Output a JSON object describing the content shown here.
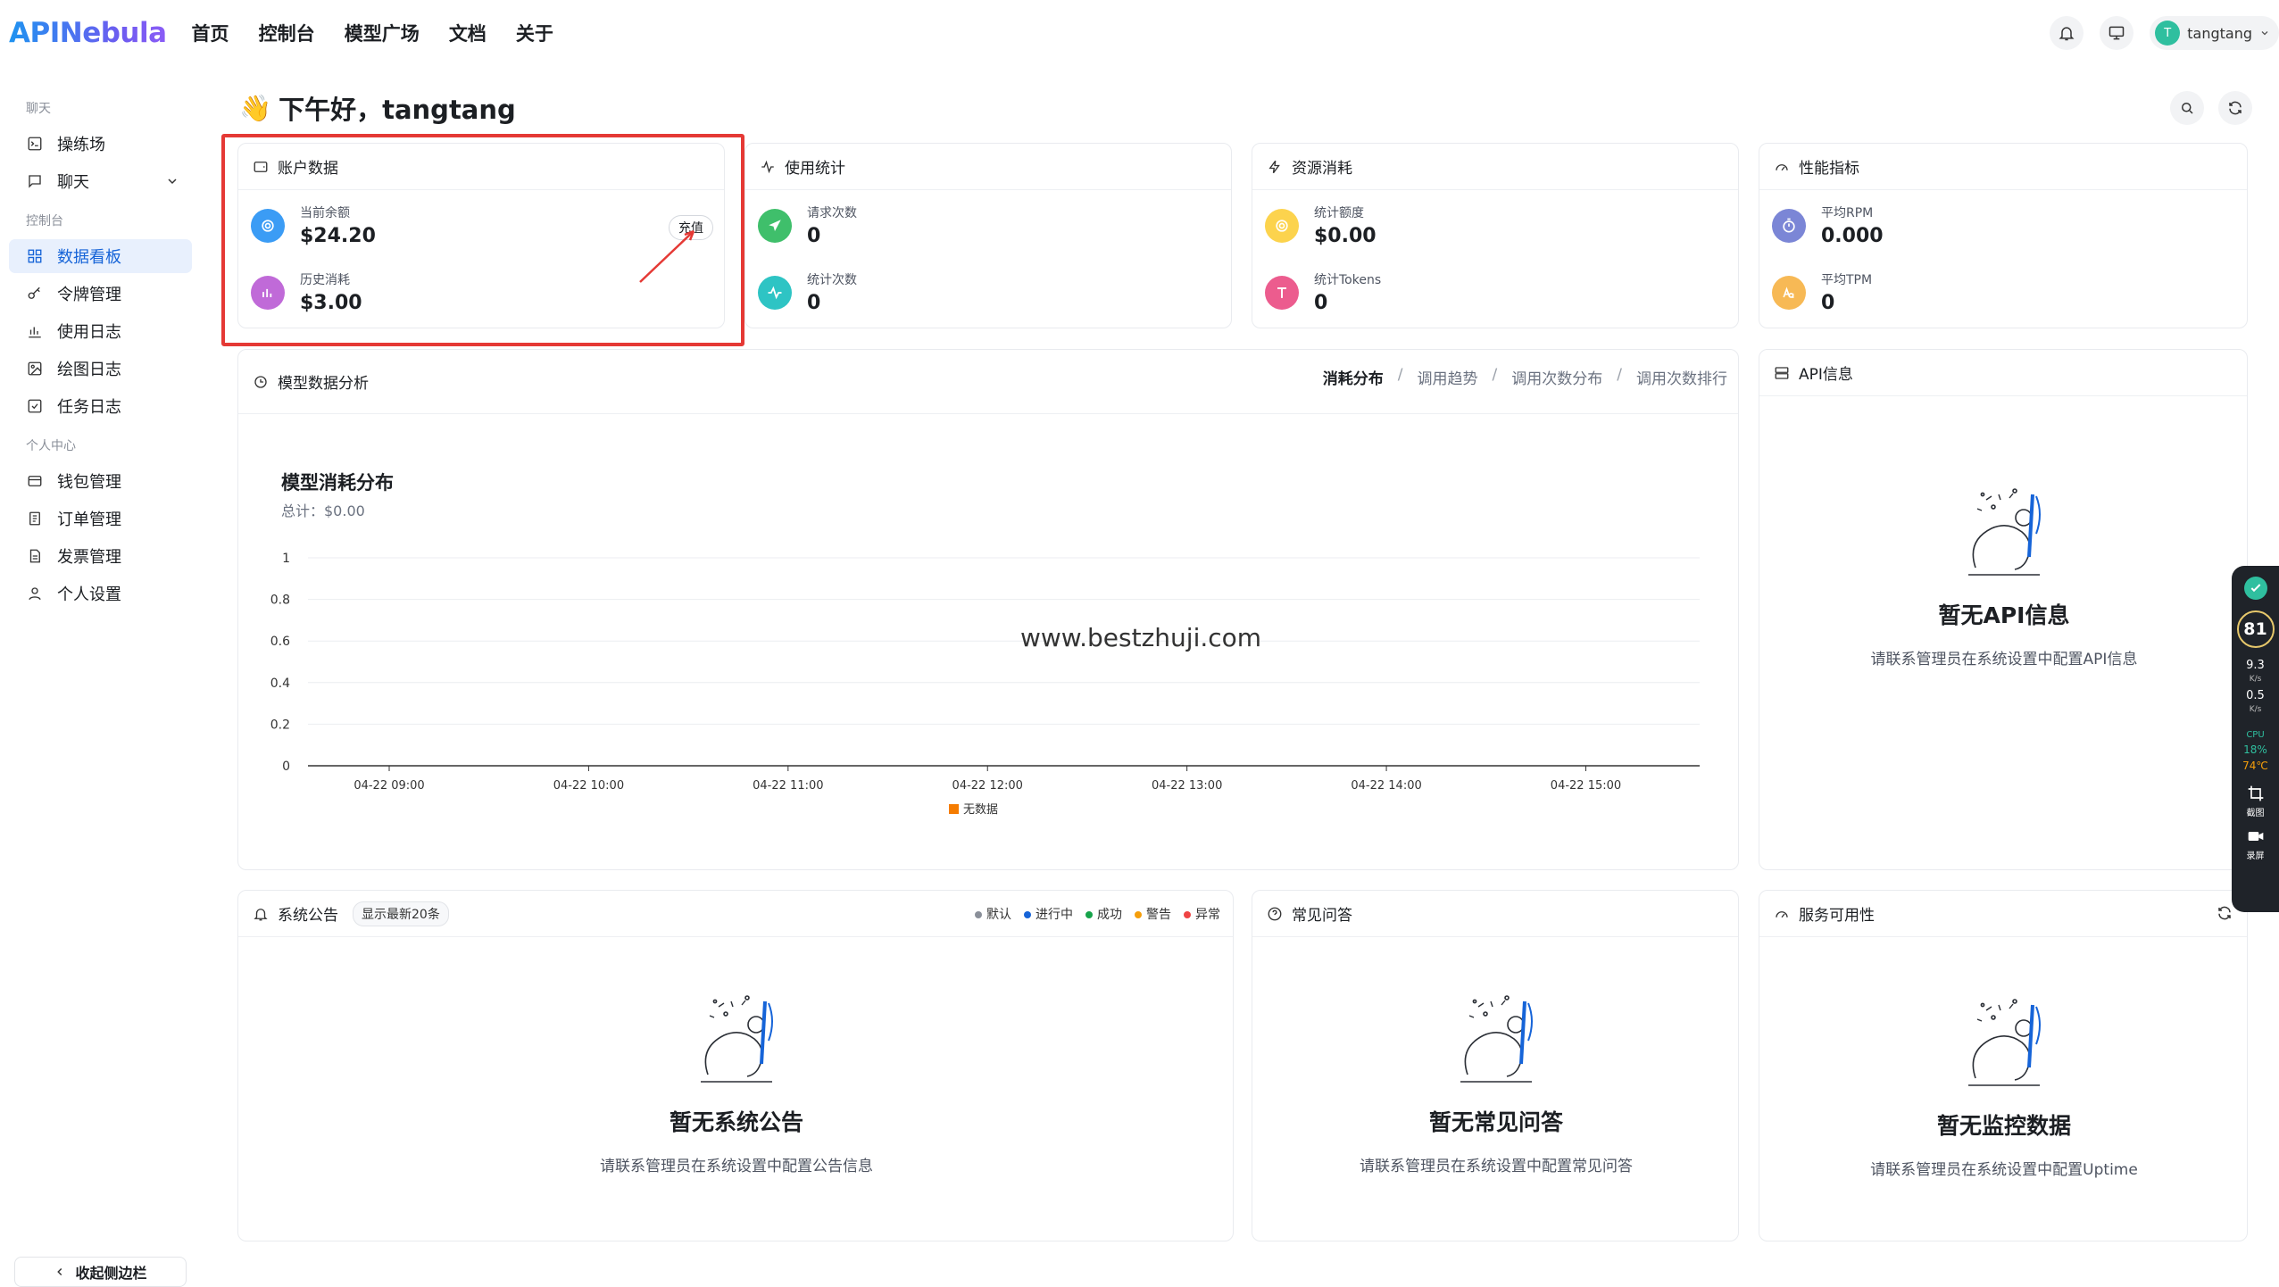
{
  "app": {
    "logo": "APINebula"
  },
  "nav": [
    "首页",
    "控制台",
    "模型广场",
    "文档",
    "关于"
  ],
  "user": {
    "initial": "T",
    "name": "tangtang"
  },
  "sidebar": {
    "group_chat": "聊天",
    "playground": "操练场",
    "chat": "聊天",
    "group_console": "控制台",
    "dashboard": "数据看板",
    "tokens": "令牌管理",
    "usage_log": "使用日志",
    "draw_log": "绘图日志",
    "task_log": "任务日志",
    "group_personal": "个人中心",
    "wallet": "钱包管理",
    "orders": "订单管理",
    "invoices": "发票管理",
    "settings": "个人设置",
    "collapse": "收起侧边栏"
  },
  "greeting": {
    "emoji": "👋",
    "text": "下午好，tangtang"
  },
  "account": {
    "title": "账户数据",
    "balance_label": "当前余额",
    "balance": "$24.20",
    "spent_label": "历史消耗",
    "spent": "$3.00",
    "recharge": "充值"
  },
  "usage": {
    "title": "使用统计",
    "requests_label": "请求次数",
    "requests": "0",
    "stat_count_label": "统计次数",
    "stat_count": "0"
  },
  "resource": {
    "title": "资源消耗",
    "quota_label": "统计额度",
    "quota": "$0.00",
    "tokens_label": "统计Tokens",
    "tokens": "0"
  },
  "perf": {
    "title": "性能指标",
    "rpm_label": "平均RPM",
    "rpm": "0.000",
    "tpm_label": "平均TPM",
    "tpm": "0"
  },
  "analysis": {
    "title": "模型数据分析",
    "tabs": [
      "消耗分布",
      "调用趋势",
      "调用次数分布",
      "调用次数排行"
    ],
    "tab_sep": "/"
  },
  "chart_data": {
    "type": "bar",
    "title": "模型消耗分布",
    "subtitle": "总计：$0.00",
    "categories": [
      "04-22 09:00",
      "04-22 10:00",
      "04-22 11:00",
      "04-22 12:00",
      "04-22 13:00",
      "04-22 14:00",
      "04-22 15:00"
    ],
    "series": [
      {
        "name": "无数据",
        "values": [
          0,
          0,
          0,
          0,
          0,
          0,
          0
        ],
        "color": "#f57c00"
      }
    ],
    "yticks": [
      "1",
      "0.8",
      "0.6",
      "0.4",
      "0.2",
      "0"
    ],
    "ylim": [
      0,
      1
    ],
    "grid": true,
    "legend": "bottom"
  },
  "watermark": "www.bestzhuji.com",
  "api_info": {
    "title": "API信息",
    "empty_title": "暂无API信息",
    "empty_desc": "请联系管理员在系统设置中配置API信息"
  },
  "announcements": {
    "title": "系统公告",
    "badge": "显示最新20条",
    "legend": [
      {
        "label": "默认",
        "color": "#8a8f99"
      },
      {
        "label": "进行中",
        "color": "#1664d8"
      },
      {
        "label": "成功",
        "color": "#16a34a"
      },
      {
        "label": "警告",
        "color": "#f59e0b"
      },
      {
        "label": "异常",
        "color": "#ef4444"
      }
    ],
    "empty_title": "暂无系统公告",
    "empty_desc": "请联系管理员在系统设置中配置公告信息"
  },
  "faq": {
    "title": "常见问答",
    "empty_title": "暂无常见问答",
    "empty_desc": "请联系管理员在系统设置中配置常见问答"
  },
  "uptime": {
    "title": "服务可用性",
    "empty_title": "暂无监控数据",
    "empty_desc": "请联系管理员在系统设置中配置Uptime"
  },
  "floatbar": {
    "score": "81",
    "up": "9.3",
    "up_unit": "K/s",
    "down": "0.5",
    "down_unit": "K/s",
    "cpu_label": "CPU",
    "cpu": "18%",
    "temp": "74℃",
    "shot": "截图",
    "rec": "录屏"
  }
}
